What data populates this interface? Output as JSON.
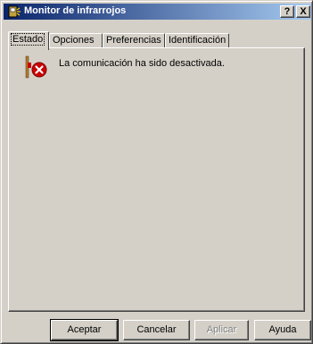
{
  "window": {
    "title": "Monitor de infrarrojos",
    "help_label": "?",
    "close_label": "X"
  },
  "tabs": [
    {
      "label": "Estado",
      "active": true
    },
    {
      "label": "Opciones",
      "active": false
    },
    {
      "label": "Preferencias",
      "active": false
    },
    {
      "label": "Identificación",
      "active": false
    }
  ],
  "status": {
    "message": "La comunicación ha sido desactivada.",
    "icon": "infrared-error-icon"
  },
  "buttons": {
    "ok": "Aceptar",
    "cancel": "Cancelar",
    "apply": "Aplicar",
    "help": "Ayuda"
  },
  "colors": {
    "titlebar_start": "#0a246a",
    "titlebar_end": "#a6caf0",
    "face": "#d4d0c8",
    "error_red": "#cc0000"
  }
}
